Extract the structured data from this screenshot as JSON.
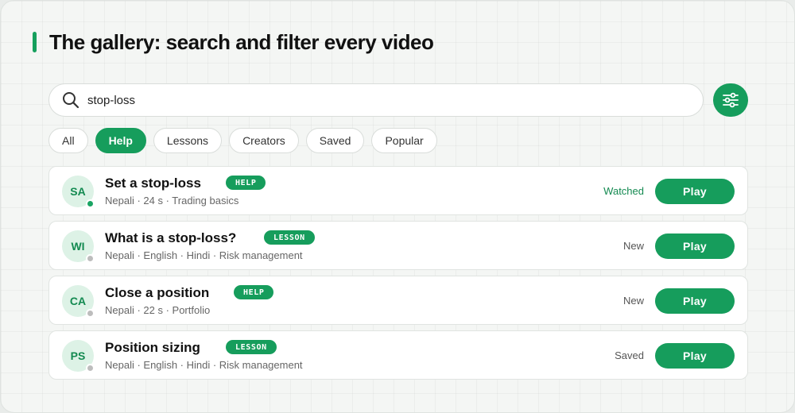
{
  "page": {
    "title": "The gallery: search and filter every video"
  },
  "search": {
    "value": "stop-loss",
    "placeholder": ""
  },
  "tabs": [
    {
      "label": "All",
      "active": false
    },
    {
      "label": "Help",
      "active": true
    },
    {
      "label": "Lessons",
      "active": false
    },
    {
      "label": "Creators",
      "active": false
    },
    {
      "label": "Saved",
      "active": false
    },
    {
      "label": "Popular",
      "active": false
    }
  ],
  "videos": [
    {
      "initials": "SA",
      "title": "Set a stop-loss",
      "badge": "HELP",
      "meta": "Nepali · 24 s · Trading basics",
      "state": "Watched",
      "online": true,
      "play_label": "Play"
    },
    {
      "initials": "WI",
      "title": "What is a stop-loss?",
      "badge": "LESSON",
      "meta": "Nepali · English · Hindi · Risk management",
      "state": "New",
      "online": false,
      "play_label": "Play"
    },
    {
      "initials": "CA",
      "title": "Close a position",
      "badge": "HELP",
      "meta": "Nepali · 22 s · Portfolio",
      "state": "New",
      "online": false,
      "play_label": "Play"
    },
    {
      "initials": "PS",
      "title": "Position sizing",
      "badge": "LESSON",
      "meta": "Nepali · English · Hindi · Risk management",
      "state": "Saved",
      "online": false,
      "play_label": "Play"
    }
  ],
  "colors": {
    "accent": "#169d5c",
    "avatar_bg": "#ddf2e6",
    "avatar_text": "#148a51",
    "offline_dot": "#bdbdbd"
  },
  "icons": {
    "search": "search-icon",
    "filter": "sliders-icon",
    "status": "status-dot-icon"
  }
}
